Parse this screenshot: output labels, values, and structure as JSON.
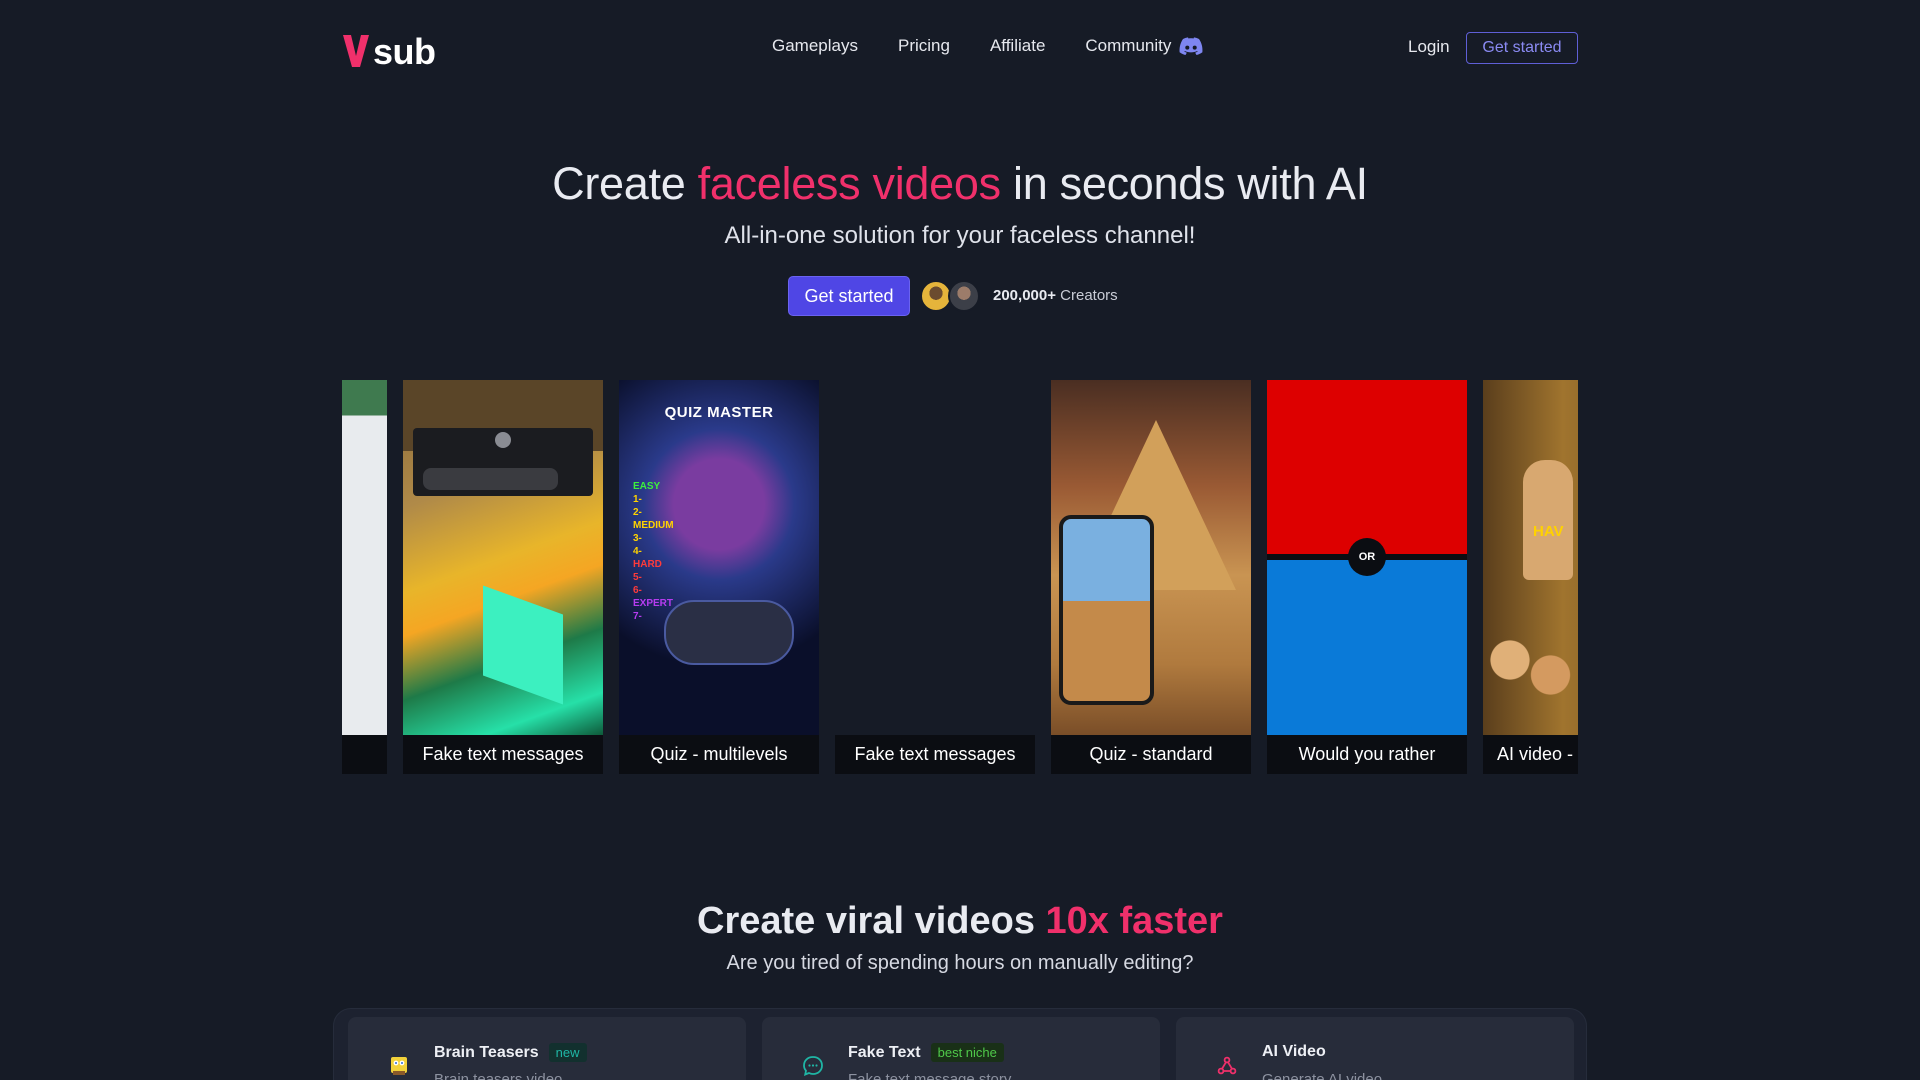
{
  "brand": {
    "logo_text": "sub",
    "logo_color": "#f0306b"
  },
  "nav": {
    "links": [
      "Gameplays",
      "Pricing",
      "Affiliate",
      "Community"
    ],
    "login": "Login",
    "cta": "Get started"
  },
  "hero": {
    "title_pre": "Create ",
    "title_accent": "faceless videos",
    "title_post": " in seconds with AI",
    "subtitle": "All-in-one solution for your faceless channel!",
    "cta": "Get started",
    "creators_count": "200,000+",
    "creators_label": " Creators"
  },
  "carousel": {
    "cards": [
      {
        "caption": "",
        "thumb": "partial"
      },
      {
        "caption": "Fake text messages",
        "thumb": "minecraft-lava"
      },
      {
        "caption": "Quiz - multilevels",
        "thumb": "quiz-master",
        "thumb_title": "QUIZ MASTER",
        "levels": [
          "EASY",
          "1-",
          "2-",
          "MEDIUM",
          "3-",
          "4-",
          "HARD",
          "5-",
          "6-",
          "EXPERT",
          "7-"
        ]
      },
      {
        "caption": "Fake text messages",
        "thumb": "empty"
      },
      {
        "caption": "Quiz - standard",
        "thumb": "pyramid-phone"
      },
      {
        "caption": "Would you rather",
        "thumb": "red-blue",
        "or_label": "OR"
      },
      {
        "caption": "AI video -",
        "thumb": "egypt-cat",
        "overlay_text": "HAV"
      }
    ]
  },
  "section2": {
    "title_pre": "Create viral videos ",
    "title_accent": "10x faster",
    "subtitle": "Are you tired of spending hours on manually editing?"
  },
  "features": [
    {
      "title": "Brain Teasers",
      "badge": "new",
      "desc": "Brain teasers video",
      "icon": "sponge-icon"
    },
    {
      "title": "Fake Text",
      "badge": "best niche",
      "desc": "Fake text message story",
      "icon": "chat-bubble-icon"
    },
    {
      "title": "AI Video",
      "badge": "",
      "desc": "Generate AI video",
      "icon": "nodes-icon"
    }
  ]
}
